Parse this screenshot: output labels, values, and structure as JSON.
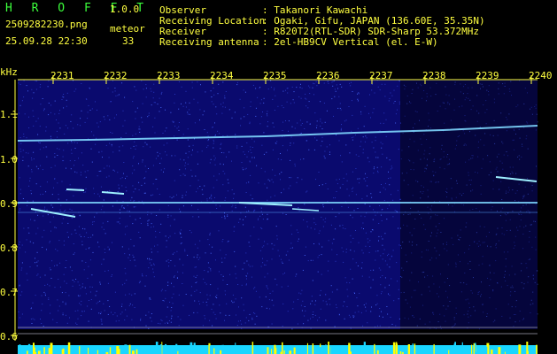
{
  "app": {
    "name": "H R O F F T",
    "version": "1.0.0"
  },
  "file": {
    "name": "2509282230.png",
    "datetime": "25.09.28 22:30"
  },
  "meteor": {
    "label": "meteor",
    "count": "33"
  },
  "info": [
    {
      "label": "Observer",
      "value": ": Takanori Kawachi"
    },
    {
      "label": "Receiving Location",
      "value": ": Ogaki, Gifu, JAPAN (136.60E, 35.35N)"
    },
    {
      "label": "Receiver",
      "value": ": R820T2(RTL-SDR) SDR-Sharp 53.372MHz"
    },
    {
      "label": "Receiving antenna",
      "value": ": 2el-HB9CV Vertical (el. E-W)"
    }
  ],
  "axis": {
    "y_unit": "kHz",
    "y_ticks": [
      "1.1",
      "1.0",
      "0.9",
      "0.8",
      "0.7",
      "0.6"
    ],
    "x_ticks": [
      "2231",
      "2232",
      "2233",
      "2234",
      "2235",
      "2236",
      "2237",
      "2238",
      "2239",
      "2240"
    ]
  },
  "colors": {
    "background": "#0a0a6e",
    "dark_region": "#05053c",
    "signal": "#7fd8ff",
    "text_yellow": "#ffff40",
    "text_green": "#3cff3c",
    "bar_cyan": "#19d6ff",
    "bar_yellow": "#ffff00"
  }
}
